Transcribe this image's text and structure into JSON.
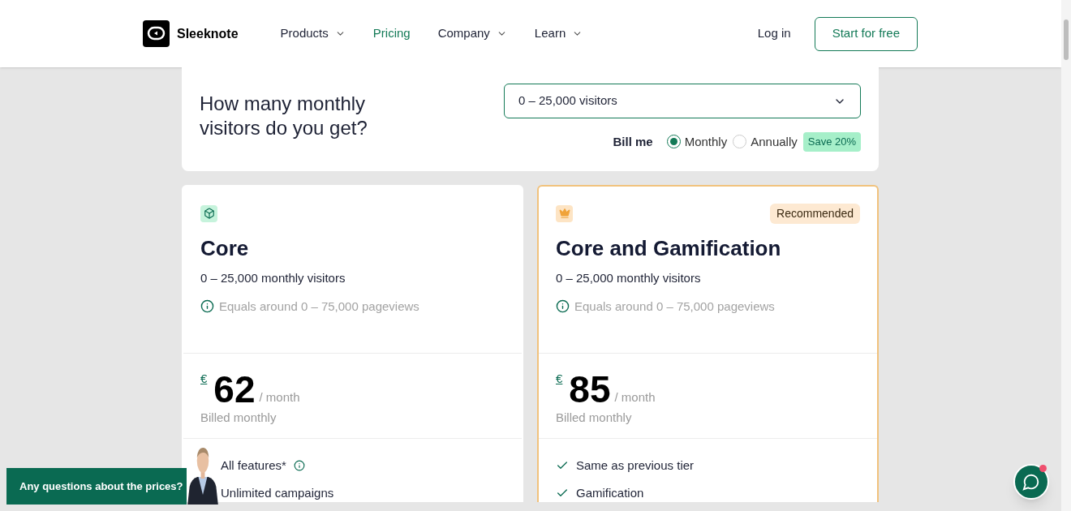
{
  "header": {
    "logo_text": "Sleeknote",
    "nav": [
      {
        "label": "Products",
        "selected": false,
        "dropdown": true
      },
      {
        "label": "Pricing",
        "selected": true,
        "dropdown": false
      },
      {
        "label": "Company",
        "selected": false,
        "dropdown": true
      },
      {
        "label": "Learn",
        "selected": false,
        "dropdown": true
      }
    ],
    "login": "Log in",
    "cta": "Start for free"
  },
  "visitors_panel": {
    "question": "How many monthly visitors do you get?",
    "select_value": "0 – 25,000 visitors",
    "bill_label": "Bill me",
    "billing": [
      {
        "label": "Monthly",
        "selected": true
      },
      {
        "label": "Annually",
        "selected": false
      }
    ],
    "save_badge": "Save 20%"
  },
  "plans": [
    {
      "name": "Core",
      "recommended": false,
      "visitors": "0 – 25,000 monthly visitors",
      "pageviews": "Equals around 0 – 75,000 pageviews",
      "currency": "€",
      "price": "62",
      "period": "/ month",
      "billed": "Billed monthly",
      "features": [
        {
          "text": "All features*",
          "info": true
        },
        {
          "text": "Unlimited campaigns",
          "info": false
        }
      ]
    },
    {
      "name": "Core and Gamification",
      "recommended": true,
      "badge": "Recommended",
      "visitors": "0 – 25,000 monthly visitors",
      "pageviews": "Equals around 0 – 75,000 pageviews",
      "currency": "€",
      "price": "85",
      "period": "/ month",
      "billed": "Billed monthly",
      "features": [
        {
          "text": "Same as previous tier",
          "info": false,
          "check": true
        },
        {
          "text": "Gamification",
          "info": false,
          "check": true
        }
      ]
    }
  ],
  "chat_banner": "Any questions about the prices?",
  "chat_button": {
    "notification": true
  }
}
